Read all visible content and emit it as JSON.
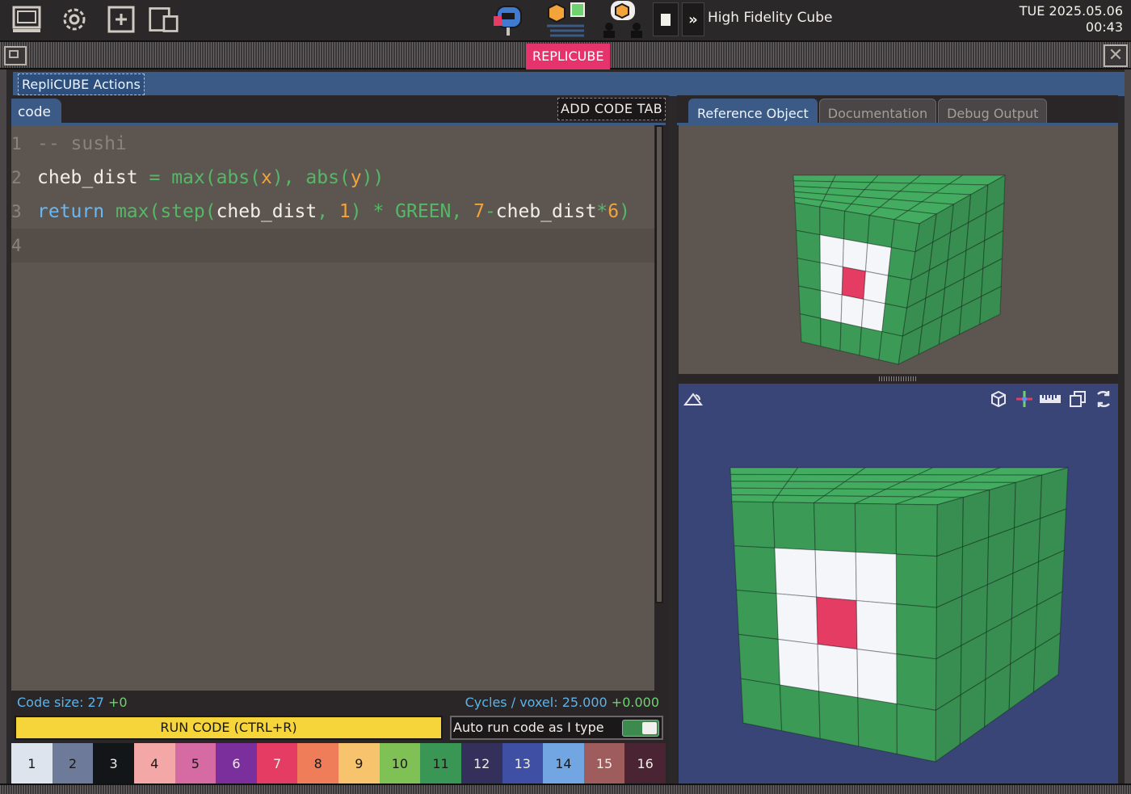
{
  "taskbar": {
    "icons": [
      "computer-icon",
      "settings-gear-icon",
      "new-file-icon",
      "windows-icon",
      "mailbox-robot-icon",
      "task-list-icon",
      "chat-people-icon"
    ],
    "level_title": "High Fidelity Cube",
    "clock_date": "TUE 2025.05.06",
    "clock_time": "00:43"
  },
  "window": {
    "title": "REPLICUBE",
    "actions_tab": "RepliCUBE Actions"
  },
  "editor": {
    "tab_label": "code",
    "add_tab_label": "ADD CODE TAB",
    "lines": [
      {
        "n": "1",
        "tokens": [
          {
            "c": "comment",
            "t": "-- sushi"
          }
        ]
      },
      {
        "n": "2",
        "tokens": [
          {
            "c": "var",
            "t": "cheb_dist "
          },
          {
            "c": "op",
            "t": "= "
          },
          {
            "c": "fn",
            "t": "max(abs("
          },
          {
            "c": "num",
            "t": "x"
          },
          {
            "c": "fn",
            "t": "), abs("
          },
          {
            "c": "num",
            "t": "y"
          },
          {
            "c": "fn",
            "t": "))"
          }
        ]
      },
      {
        "n": "3",
        "tokens": [
          {
            "c": "kw",
            "t": "return "
          },
          {
            "c": "fn",
            "t": "max(step("
          },
          {
            "c": "var",
            "t": "cheb_dist"
          },
          {
            "c": "fn",
            "t": ", "
          },
          {
            "c": "num",
            "t": "1"
          },
          {
            "c": "fn",
            "t": ") * GREEN, "
          },
          {
            "c": "num",
            "t": "7"
          },
          {
            "c": "fn",
            "t": "-"
          },
          {
            "c": "var",
            "t": "cheb_dist"
          },
          {
            "c": "fn",
            "t": "*"
          },
          {
            "c": "num",
            "t": "6"
          },
          {
            "c": "fn",
            "t": ")"
          }
        ]
      },
      {
        "n": "4",
        "tokens": []
      }
    ],
    "code_size_label": "Code size: 27",
    "code_size_delta": "+0",
    "cycles_label": "Cycles / voxel: 25.000",
    "cycles_delta": "+0.000",
    "run_label": "RUN CODE (CTRL+R)",
    "auto_run_label": "Auto run code as I type",
    "auto_run_on": true
  },
  "palette": [
    {
      "label": "1",
      "bg": "#dde4ee",
      "fg": "#1a1819"
    },
    {
      "label": "2",
      "bg": "#6d7a99",
      "fg": "#1a1819"
    },
    {
      "label": "3",
      "bg": "#131619",
      "fg": "#f0ede8"
    },
    {
      "label": "4",
      "bg": "#f4a7a7",
      "fg": "#1a1819"
    },
    {
      "label": "5",
      "bg": "#d56ba2",
      "fg": "#1a1819"
    },
    {
      "label": "6",
      "bg": "#7b2f9c",
      "fg": "#f0ede8"
    },
    {
      "label": "7",
      "bg": "#e43c63",
      "fg": "#f0ede8"
    },
    {
      "label": "8",
      "bg": "#f07d59",
      "fg": "#1a1819"
    },
    {
      "label": "9",
      "bg": "#f7c36d",
      "fg": "#1a1819"
    },
    {
      "label": "10",
      "bg": "#7fc155",
      "fg": "#1a1819"
    },
    {
      "label": "11",
      "bg": "#3a9655",
      "fg": "#1a1819"
    },
    {
      "label": "12",
      "bg": "#33305c",
      "fg": "#f0ede8"
    },
    {
      "label": "13",
      "bg": "#3f4fa4",
      "fg": "#f0ede8"
    },
    {
      "label": "14",
      "bg": "#72a6e2",
      "fg": "#1a1819"
    },
    {
      "label": "15",
      "bg": "#9f5c5c",
      "fg": "#f0ede8"
    },
    {
      "label": "16",
      "bg": "#4a2432",
      "fg": "#f0ede8"
    }
  ],
  "reference": {
    "tabs": [
      "Reference Object",
      "Documentation",
      "Debug Output"
    ],
    "active_tab": 0
  },
  "viewport": {
    "left_icons": [
      "rotate-view-icon"
    ],
    "right_icons": [
      "wireframe-cube-icon",
      "axes-icon",
      "ruler-icon",
      "layers-icon",
      "reset-rotation-icon"
    ]
  },
  "colors": {
    "accent_blue": "#3b5a86",
    "run_yellow": "#f5d53a",
    "title_pink": "#e6336b",
    "cube_green": "#3c9a57",
    "cube_white": "#f4f6fa",
    "cube_red": "#e43c63"
  }
}
